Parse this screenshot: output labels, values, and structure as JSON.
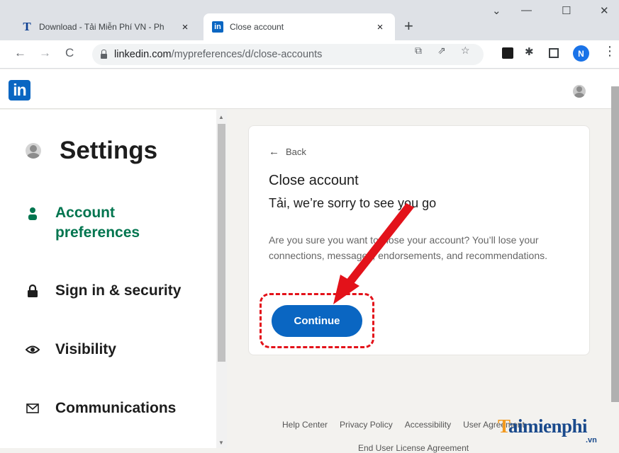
{
  "browser": {
    "tabs": [
      {
        "favicon": "T",
        "title": "Download - Tải Miễn Phí VN - Ph",
        "close": "×"
      },
      {
        "favicon": "in",
        "title": "Close account",
        "close": "×"
      }
    ],
    "new_tab": "+",
    "window_controls": {
      "minimize": "—",
      "maximize": "☐",
      "close": "✕",
      "menu": "⌄"
    },
    "url_domain": "linkedin.com",
    "url_path": "/mypreferences/d/close-accounts",
    "profile_initial": "N"
  },
  "linkedin": {
    "logo": "in"
  },
  "sidebar": {
    "title": "Settings",
    "items": [
      {
        "label": "Account preferences",
        "icon": "person-icon",
        "active": true
      },
      {
        "label": "Sign in & security",
        "icon": "lock-icon"
      },
      {
        "label": "Visibility",
        "icon": "eye-icon"
      },
      {
        "label": "Communications",
        "icon": "envelope-icon"
      }
    ]
  },
  "card": {
    "back": "Back",
    "title": "Close account",
    "subtitle": "Tải, we’re sorry to see you go",
    "body": "Are you sure you want to close your account? You’ll lose your connections, messages, endorsements, and recommendations.",
    "button": "Continue"
  },
  "footer": {
    "links": [
      "Help Center",
      "Privacy Policy",
      "Accessibility",
      "User Agreement"
    ],
    "second_line": "End User License Agreement"
  },
  "watermark": {
    "text_first": "T",
    "text_rest": "aimienphi",
    "suffix": ".vn"
  },
  "colors": {
    "linkedin_blue": "#0a66c2",
    "active_green": "#01754f",
    "annotation_red": "#e3121a"
  }
}
